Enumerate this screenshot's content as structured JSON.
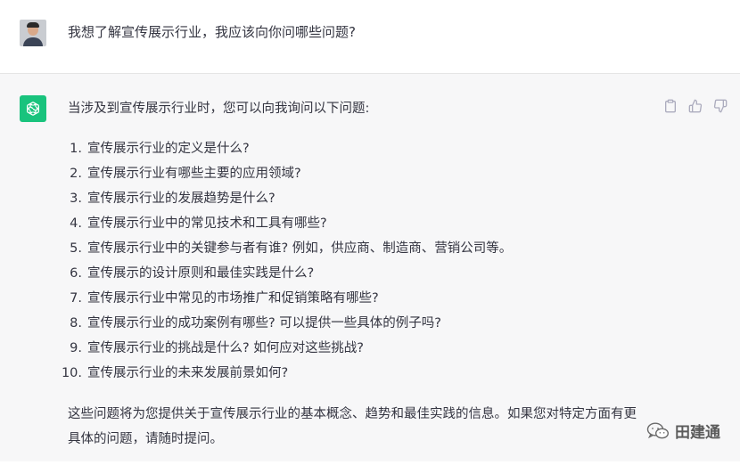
{
  "user_message": {
    "text": "我想了解宣传展示行业，我应该向你问哪些问题?"
  },
  "assistant_message": {
    "intro": "当涉及到宣传展示行业时，您可以向我询问以下问题:",
    "questions": [
      {
        "num": "1.",
        "text": "宣传展示行业的定义是什么?"
      },
      {
        "num": "2.",
        "text": "宣传展示行业有哪些主要的应用领域?"
      },
      {
        "num": "3.",
        "text": "宣传展示行业的发展趋势是什么?"
      },
      {
        "num": "4.",
        "text": "宣传展示行业中的常见技术和工具有哪些?"
      },
      {
        "num": "5.",
        "text": "宣传展示行业中的关键参与者有谁? 例如，供应商、制造商、营销公司等。"
      },
      {
        "num": "6.",
        "text": "宣传展示的设计原则和最佳实践是什么?"
      },
      {
        "num": "7.",
        "text": "宣传展示行业中常见的市场推广和促销策略有哪些?"
      },
      {
        "num": "8.",
        "text": "宣传展示行业的成功案例有哪些? 可以提供一些具体的例子吗?"
      },
      {
        "num": "9.",
        "text": "宣传展示行业的挑战是什么? 如何应对这些挑战?"
      },
      {
        "num": "10.",
        "text": "宣传展示行业的未来发展前景如何?"
      }
    ],
    "conclusion": "这些问题将为您提供关于宣传展示行业的基本概念、趋势和最佳实践的信息。如果您对特定方面有更具体的问题，请随时提问。"
  },
  "actions": {
    "copy_icon": "clipboard-icon",
    "like_icon": "thumbs-up-icon",
    "dislike_icon": "thumbs-down-icon"
  },
  "watermark": {
    "text": "田建通"
  },
  "colors": {
    "brand_green": "#19c37d",
    "assistant_bg": "#f7f7f8",
    "text": "#343541",
    "icon_gray": "#acacbe"
  }
}
